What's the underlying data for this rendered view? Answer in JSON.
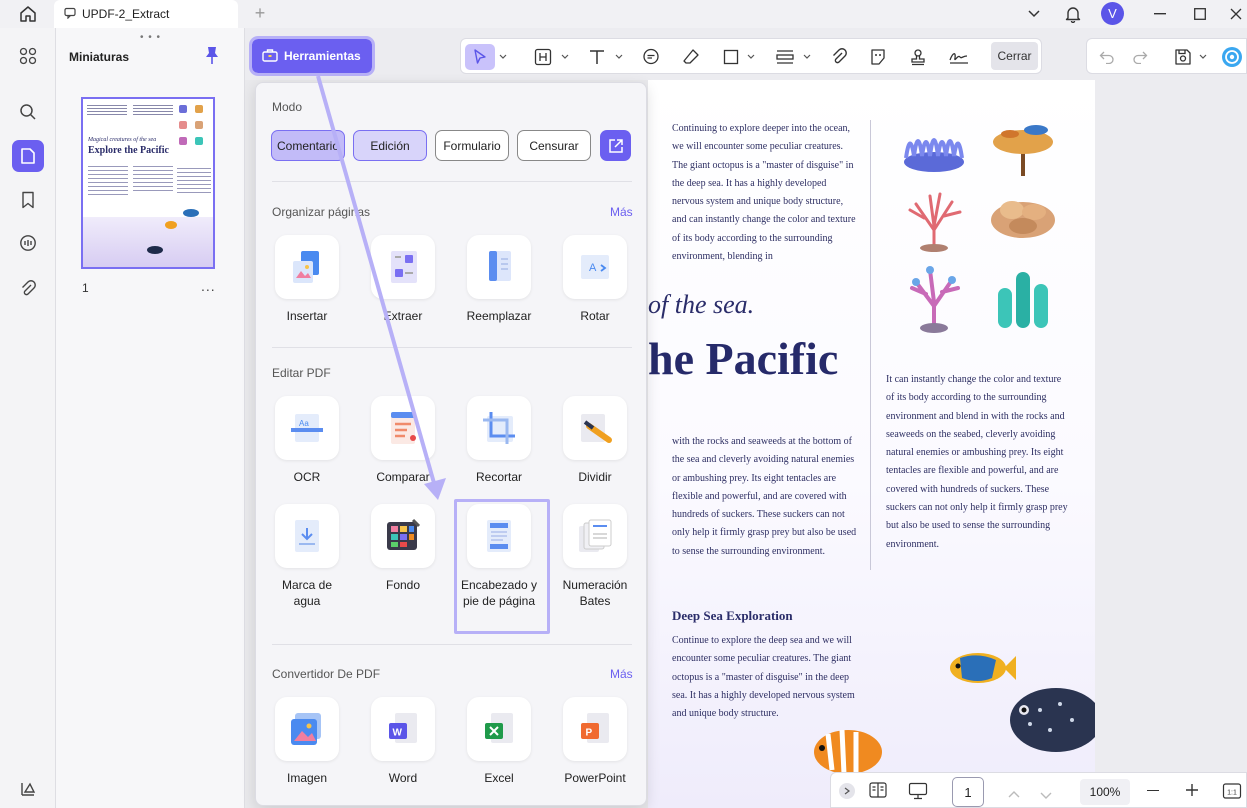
{
  "window": {
    "tab_title": "UPDF-2_Extract",
    "avatar_letter": "V",
    "accent": "#6b5ff0"
  },
  "sidebar": {
    "panel_title": "Miniaturas",
    "thumbnail_page_number": "1",
    "thumbnail_title_small": "Magical creatures of the sea",
    "thumbnail_title": "Explore the Pacific",
    "thumbnail_more": "..."
  },
  "toolbar": {
    "tools_label": "Herramientas",
    "close_label": "Cerrar"
  },
  "popup": {
    "mode_label": "Modo",
    "modes": [
      "Comentario",
      "Edición",
      "Formulario",
      "Censurar"
    ],
    "sections": [
      {
        "title": "Organizar páginas",
        "more": "Más",
        "items": [
          "Insertar",
          "Extraer",
          "Reemplazar",
          "Rotar"
        ]
      },
      {
        "title": "Editar PDF",
        "more": "",
        "items": [
          "OCR",
          "Comparar",
          "Recortar",
          "Dividir",
          "Marca de agua",
          "Fondo",
          "Encabezado y pie de página",
          "Numeración Bates"
        ]
      },
      {
        "title": "Convertidor De PDF",
        "more": "Más",
        "items": [
          "Imagen",
          "Word",
          "Excel",
          "PowerPoint"
        ]
      }
    ]
  },
  "document": {
    "para1": "Continuing to explore deeper into the ocean, we will encounter some peculiar creatures. The giant octopus is a \"master of disguise\" in the deep sea. It has a highly developed nervous system and unique body structure, and can instantly change the color and texture of its body according to the surrounding environment, blending in",
    "title_italic": "of the sea.",
    "title_big": "he Pacific",
    "para2": "with the rocks and seaweeds at the bottom of the sea and cleverly avoiding natural enemies or ambushing prey. Its eight tentacles are flexible and powerful, and are covered with hundreds of suckers. These suckers can not only help it firmly grasp prey but also be used to sense the surrounding environment.",
    "para3": "It can instantly change the color and texture of its body according to the surrounding environment and blend in with the rocks and seaweeds on the seabed, cleverly avoiding natural enemies or ambushing prey. Its eight tentacles are flexible and powerful, and are covered with hundreds of suckers. These suckers can not only help it firmly grasp prey but also be used to sense the surrounding environment.",
    "heading_deep": "Deep Sea Exploration",
    "para4": "Continue to explore the deep sea and we will encounter some peculiar creatures. The giant octopus is a \"master of disguise\" in the deep sea. It has a highly developed nervous system and unique body structure."
  },
  "bottom_nav": {
    "page": "1",
    "zoom": "100%"
  }
}
